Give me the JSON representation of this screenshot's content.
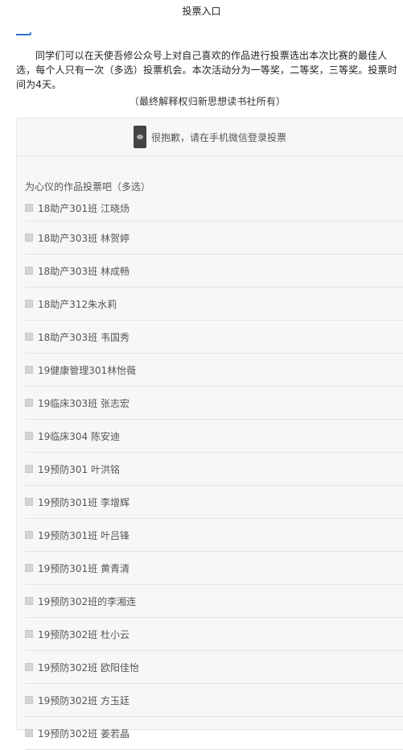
{
  "page": {
    "title": "投票入口",
    "intro": "同学们可以在天使吾修公众号上对自己喜欢的作品进行投票选出本次比赛的最佳人选，每个人只有一次（多选）投票机会。本次活动分为一等奖，二等奖，三等奖。投票时间为4天。",
    "note": "（最终解释权归新思想读书社所有）"
  },
  "notice": {
    "icon": "wechat-icon",
    "text": "很抱歉，请在手机微信登录投票"
  },
  "vote": {
    "heading": "为心仪的作品投票吧（多选）",
    "options": [
      "18助产301班 江晓炀",
      "18助产303班 林贺婷",
      "18助产303班 林成畅",
      "18助产312朱水莉",
      "18助产303班 韦国秀",
      "19健康管理301林怡薇",
      "19临床303班 张志宏",
      "19临床304 陈安迪",
      "19预防301 叶洪铭",
      "19预防301班 李增辉",
      "19预防301班 叶吕锋",
      "19预防301班 黄青清",
      "19预防302班的李湘连",
      "19预防302班 杜小云",
      "19预防302班 欧阳佳怡",
      "19预防302班 方玉廷",
      "19预防302班 姜若晶"
    ]
  },
  "colors": {
    "accent": "#2e6fd3",
    "panel_bg": "#f7f7f7",
    "divider": "#e4e4e4"
  }
}
